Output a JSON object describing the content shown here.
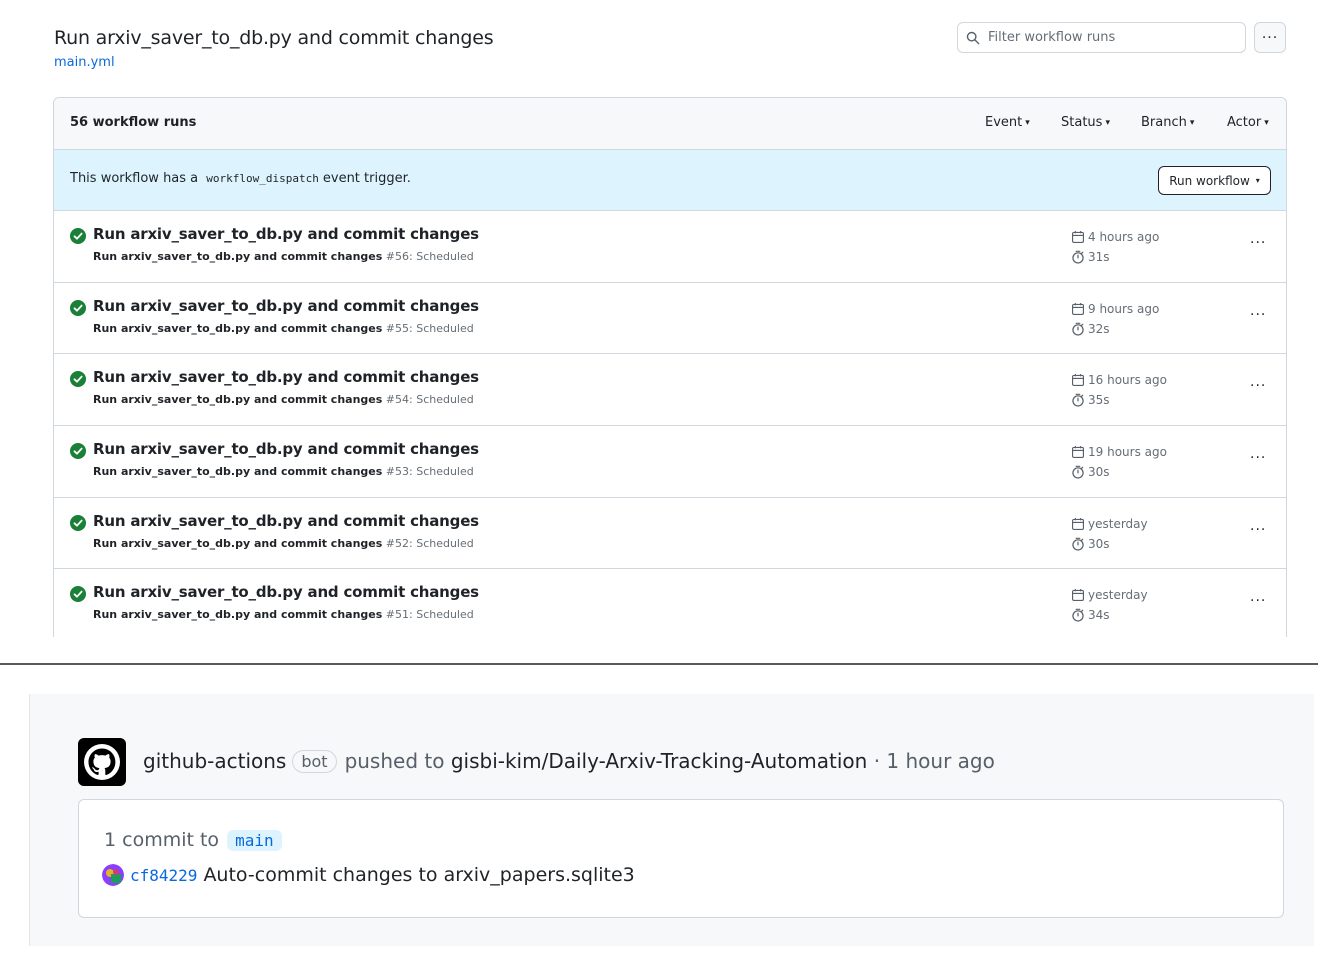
{
  "workflow": {
    "title": "Run arxiv_saver_to_db.py and commit changes",
    "file": "main.yml"
  },
  "filter": {
    "placeholder": "Filter workflow runs"
  },
  "kebab": "···",
  "runs_header": {
    "count": "56 workflow runs",
    "filters": [
      "Event",
      "Status",
      "Branch",
      "Actor"
    ]
  },
  "dispatch": {
    "pre": "This workflow has a",
    "code": "workflow_dispatch",
    "post": "event trigger.",
    "button": "Run workflow"
  },
  "runs": [
    {
      "title": "Run arxiv_saver_to_db.py and commit changes",
      "name": "Run arxiv_saver_to_db.py and commit changes",
      "detail": "#56: Scheduled",
      "time": "4 hours ago",
      "duration": "31s"
    },
    {
      "title": "Run arxiv_saver_to_db.py and commit changes",
      "name": "Run arxiv_saver_to_db.py and commit changes",
      "detail": "#55: Scheduled",
      "time": "9 hours ago",
      "duration": "32s"
    },
    {
      "title": "Run arxiv_saver_to_db.py and commit changes",
      "name": "Run arxiv_saver_to_db.py and commit changes",
      "detail": "#54: Scheduled",
      "time": "16 hours ago",
      "duration": "35s"
    },
    {
      "title": "Run arxiv_saver_to_db.py and commit changes",
      "name": "Run arxiv_saver_to_db.py and commit changes",
      "detail": "#53: Scheduled",
      "time": "19 hours ago",
      "duration": "30s"
    },
    {
      "title": "Run arxiv_saver_to_db.py and commit changes",
      "name": "Run arxiv_saver_to_db.py and commit changes",
      "detail": "#52: Scheduled",
      "time": "yesterday",
      "duration": "30s"
    },
    {
      "title": "Run arxiv_saver_to_db.py and commit changes",
      "name": "Run arxiv_saver_to_db.py and commit changes",
      "detail": "#51: Scheduled",
      "time": "yesterday",
      "duration": "34s"
    }
  ],
  "feed": {
    "actor": "github-actions",
    "badge": "bot",
    "action": "pushed to",
    "repo": "gisbi-kim/Daily-Arxiv-Tracking-Automation",
    "time": "· 1 hour ago",
    "commit_count": "1 commit to",
    "branch": "main",
    "sha": "cf84229",
    "message": "Auto-commit changes to arxiv_papers.sqlite3"
  },
  "colors": {
    "success": "#1a7f37",
    "link": "#0969da",
    "dispatch_bg": "#ddf4ff",
    "header_bg": "#f6f8fa",
    "border": "#d0d7de"
  },
  "icons": {
    "search": "search-icon",
    "check": "check-circle-icon",
    "calendar": "calendar-icon",
    "stopwatch": "stopwatch-icon",
    "kebab": "kebab-horizontal-icon",
    "github": "github-mark-icon"
  }
}
